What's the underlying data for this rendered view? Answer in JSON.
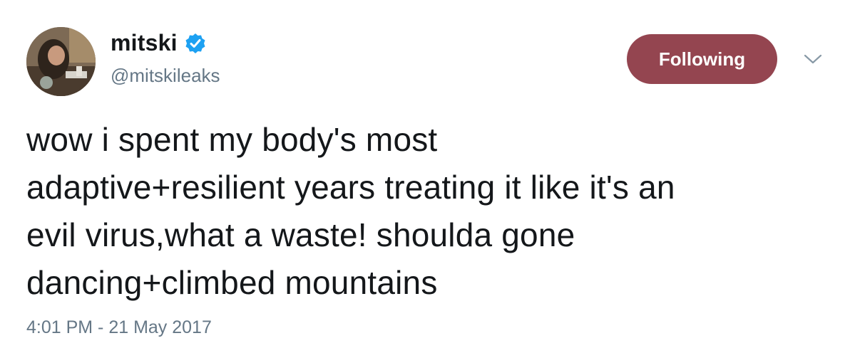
{
  "author": {
    "display_name": "mitski",
    "handle": "@mitskileaks",
    "verified_icon": "verified-badge-icon",
    "avatar": "profile-photo"
  },
  "follow_button": {
    "label": "Following",
    "color": "#944550"
  },
  "menu": {
    "icon": "chevron-down-icon"
  },
  "tweet": {
    "lines": [
      "wow i spent my body's most",
      "adaptive+resilient years treating it like it's an",
      "evil virus,what a waste! shoulda gone",
      "dancing+climbed mountains"
    ]
  },
  "timestamp": "4:01 PM - 21 May 2017",
  "colors": {
    "verified": "#1da1f2",
    "text": "#14171a",
    "muted": "#657786"
  }
}
